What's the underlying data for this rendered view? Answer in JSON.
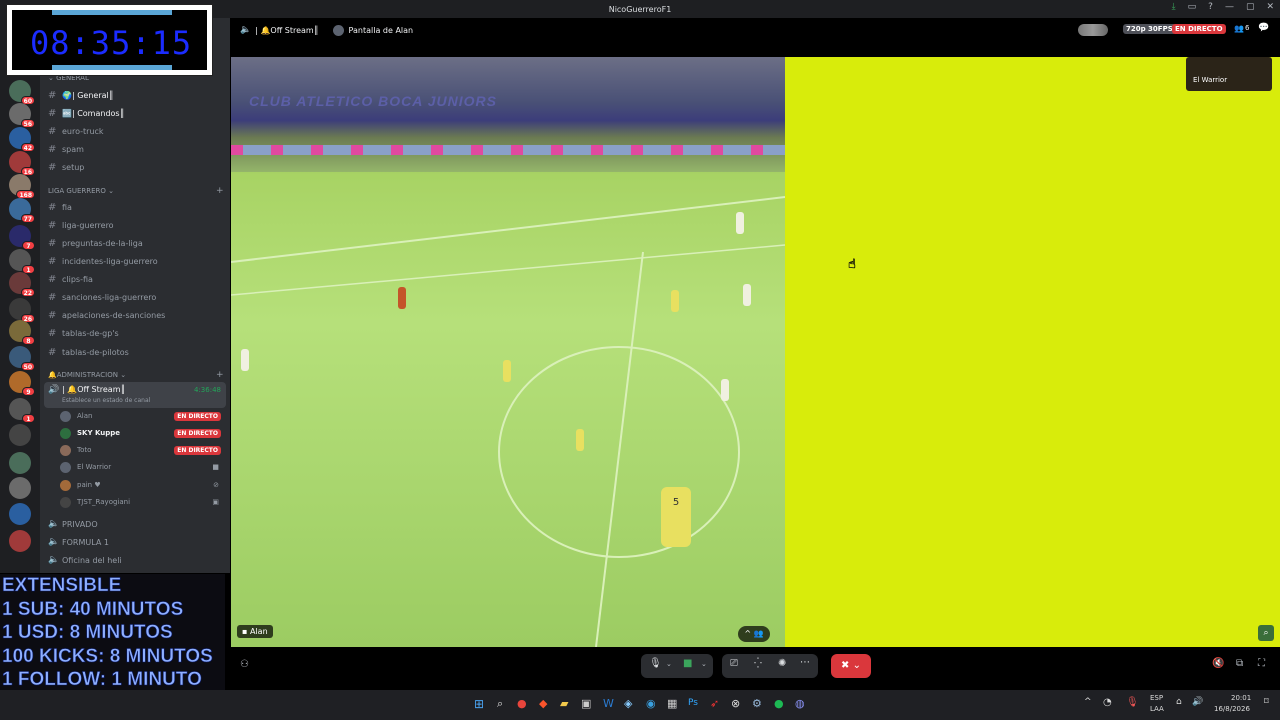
{
  "window": {
    "title": "NicoGuerreroF1"
  },
  "header": {
    "channel_label": "| 🔔Off Stream║",
    "screen_label": "Pantalla de Alan",
    "quality_badge": "720p 30FPS",
    "live_badge": "EN DIRECTO",
    "viewer_count": "6"
  },
  "server_badges": [
    "60",
    "56",
    "42",
    "16",
    "168",
    "77",
    "7",
    "1",
    "22",
    "26",
    "8",
    "50",
    "9",
    "1"
  ],
  "sidebar": {
    "categories": [
      {
        "label": "GENERAL",
        "channels": [
          "🌍| General║",
          "🔤| Comandos║",
          "euro-truck",
          "spam",
          "setup"
        ]
      },
      {
        "label": "LIGA GUERRERO",
        "channels": [
          "fia",
          "liga-guerrero",
          "preguntas-de-la-liga",
          "incidentes-liga-guerrero",
          "clips-fia",
          "sanciones-liga-guerrero",
          "apelaciones-de-sanciones",
          "tablas-de-gp's",
          "tablas-de-pilotos"
        ]
      },
      {
        "label": "ADMINISTRACION"
      }
    ],
    "voice": {
      "name": "| 🔔Off Stream║",
      "time": "4:36:48",
      "status": "Establece un estado de canal",
      "members": [
        {
          "name": "Alan",
          "live": "EN DIRECTO"
        },
        {
          "name": "SKY Kuppe",
          "live": "EN DIRECTO"
        },
        {
          "name": "Toto",
          "live": "EN DIRECTO"
        },
        {
          "name": "El Warrior"
        },
        {
          "name": "pain ♥"
        },
        {
          "name": "TJST_Rayogiani"
        }
      ]
    },
    "other_voice": [
      "PRIVADO",
      "FORMULA 1",
      "Oficina del heli"
    ]
  },
  "overlay": {
    "timer": "08:35:15",
    "extensible_lines": [
      "EXTENSIBLE",
      "1 SUB: 40 MINUTOS",
      "1 USD: 8 MINUTOS",
      "100 KICKS: 8 MINUTOS",
      "1 FOLLOW: 1 MINUTO"
    ]
  },
  "stream": {
    "banner_text": "CLUB ATLETICO BOCA JUNIORS",
    "player_number": "5",
    "tile_name": "Alan",
    "pip_name": "El Warrior"
  },
  "taskbar": {
    "lang_top": "ESP",
    "lang_bottom": "LAA",
    "time": "20:01",
    "date": "16/8/2026"
  },
  "colors": {
    "accent_live": "#da373c",
    "stream_yellow": "#d8ec0b"
  }
}
